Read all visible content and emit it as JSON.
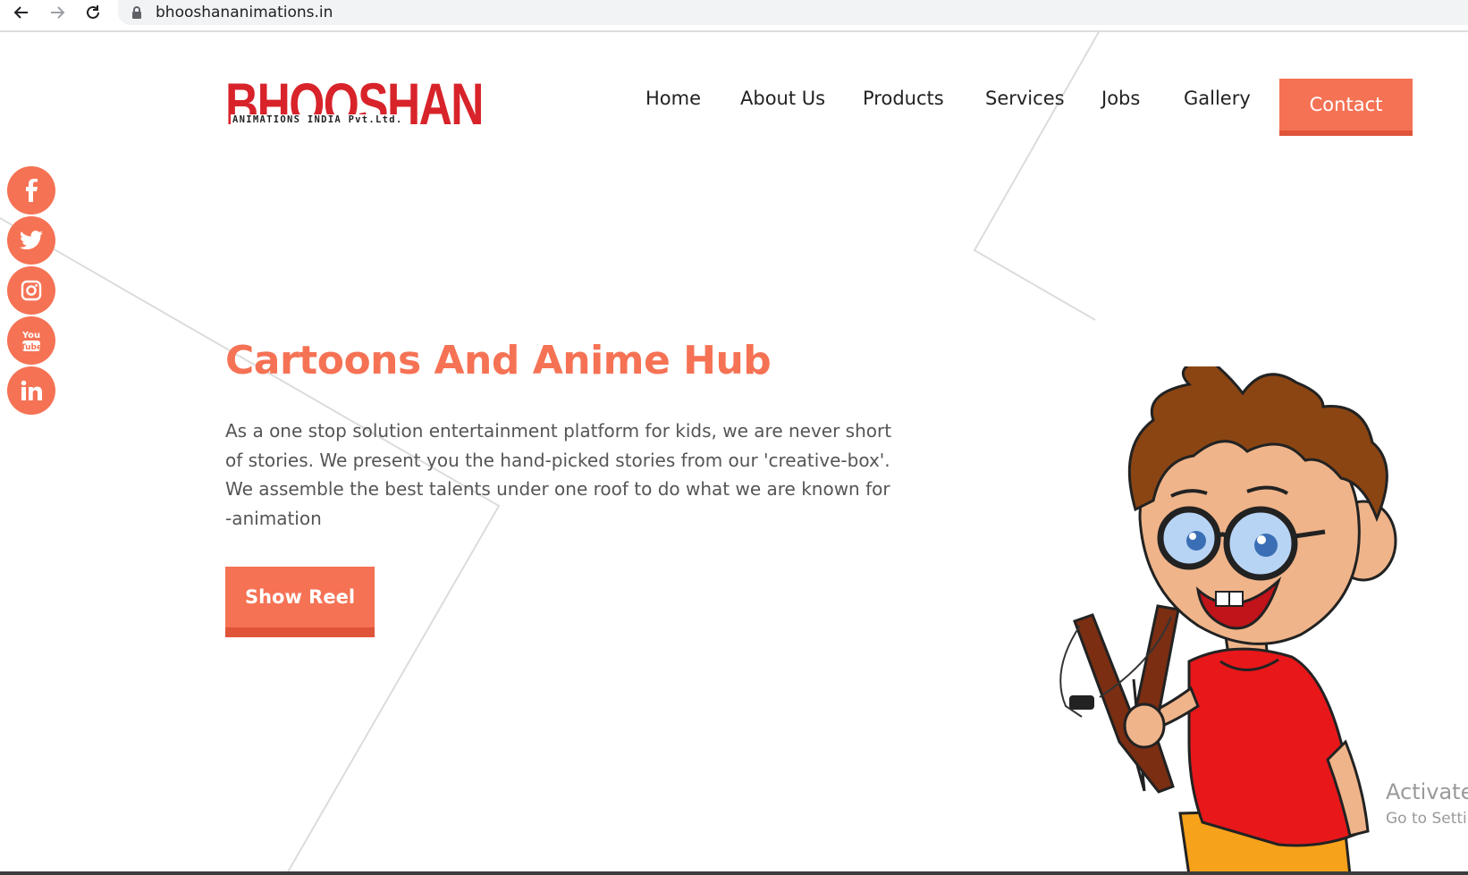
{
  "browser": {
    "url": "bhooshananimations.in",
    "back_icon": "arrow-left-icon",
    "forward_icon": "arrow-right-icon",
    "reload_icon": "reload-icon",
    "lock_icon": "lock-icon"
  },
  "logo": {
    "word": "BHOOSHAN",
    "subtitle": "ANIMATIONS INDIA Pvt.Ltd."
  },
  "nav": {
    "items": [
      {
        "label": "Home"
      },
      {
        "label": "About Us"
      },
      {
        "label": "Products"
      },
      {
        "label": "Services"
      },
      {
        "label": "Jobs"
      },
      {
        "label": "Gallery"
      }
    ],
    "contact_label": "Contact"
  },
  "social": {
    "icons": [
      "facebook-icon",
      "twitter-icon",
      "instagram-icon",
      "youtube-icon",
      "linkedin-icon"
    ]
  },
  "hero": {
    "title": "Cartoons And Anime Hub",
    "description_lines": [
      "As a one stop solution entertainment platform for kids, we are never short",
      "of stories. We present you the hand-picked stories from our 'creative-box'.",
      "We assemble the best talents under one roof to do what we are known for",
      "-animation"
    ],
    "button_label": "Show Reel"
  },
  "watermark": {
    "line1": "Activate",
    "line2": "Go to Settir"
  },
  "colors": {
    "accent": "#f57254",
    "accent_dark": "#e0543a",
    "logo_red": "#d8232a"
  }
}
